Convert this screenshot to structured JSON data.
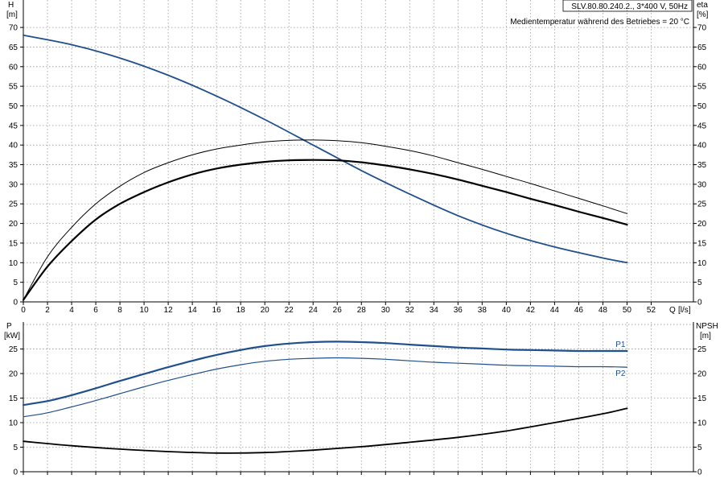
{
  "header": {
    "pump_label": "SLV.80.80.240.2., 3*400 V, 50Hz",
    "medium_note": "Medientemperatur während des Betriebes = 20 °C"
  },
  "chart_data": [
    {
      "type": "line",
      "name": "head-efficiency",
      "axes": {
        "y_left_label": "H",
        "y_left_unit": "[m]",
        "y_right_label": "eta",
        "y_right_unit": "[%]",
        "x_label": "Q",
        "x_unit": "[l/s]"
      },
      "xlim": [
        0,
        55.5
      ],
      "ylim": [
        0,
        77
      ],
      "xticks": [
        0,
        2,
        4,
        6,
        8,
        10,
        12,
        14,
        16,
        18,
        20,
        22,
        24,
        26,
        28,
        30,
        32,
        34,
        36,
        38,
        40,
        42,
        44,
        46,
        48,
        50,
        52
      ],
      "yticks": [
        0,
        5,
        10,
        15,
        20,
        25,
        30,
        35,
        40,
        45,
        50,
        55,
        60,
        65,
        70
      ],
      "grid": true,
      "series": [
        {
          "role": "head",
          "color": "#1f4f8c",
          "width": 1.8,
          "x": [
            0,
            4,
            8,
            12,
            16,
            20,
            24,
            28,
            32,
            36,
            40,
            44,
            48,
            50
          ],
          "y": [
            68,
            65.6,
            62.2,
            57.8,
            52.5,
            46.5,
            40,
            33.5,
            27.5,
            22,
            17.5,
            14,
            11.2,
            10
          ]
        },
        {
          "role": "eta",
          "color": "#000000",
          "width": 1.0,
          "x": [
            0,
            2,
            4,
            6,
            8,
            10,
            12,
            14,
            16,
            18,
            20,
            22,
            24,
            26,
            28,
            30,
            32,
            34,
            36,
            38,
            40,
            42,
            44,
            46,
            48,
            50
          ],
          "y": [
            0.5,
            11.5,
            19,
            25,
            29.5,
            33,
            35.5,
            37.5,
            39,
            40,
            40.8,
            41.2,
            41.3,
            41.1,
            40.6,
            39.7,
            38.6,
            37.2,
            35.5,
            33.8,
            32,
            30.2,
            28.3,
            26.4,
            24.5,
            22.5
          ]
        },
        {
          "role": "eta-2",
          "color": "#000000",
          "width": 2.2,
          "x": [
            0,
            2,
            4,
            6,
            8,
            10,
            12,
            14,
            16,
            18,
            20,
            22,
            24,
            26,
            28,
            30,
            32,
            34,
            36,
            38,
            40,
            42,
            44,
            46,
            48,
            50
          ],
          "y": [
            0.5,
            9,
            15.5,
            21,
            25,
            28,
            30.5,
            32.5,
            34,
            35,
            35.7,
            36.1,
            36.2,
            36.1,
            35.6,
            34.8,
            33.8,
            32.6,
            31.2,
            29.6,
            28,
            26.3,
            24.7,
            23,
            21.4,
            19.7
          ]
        }
      ]
    },
    {
      "type": "line",
      "name": "power-npsh",
      "axes": {
        "y_left_label": "P",
        "y_left_unit": "[kW]",
        "y_right_label": "NPSH",
        "y_right_unit": "[m]"
      },
      "xlim": [
        0,
        55.5
      ],
      "ylim": [
        0,
        30.5
      ],
      "yticks": [
        0,
        5,
        10,
        15,
        20,
        25
      ],
      "grid": true,
      "series": [
        {
          "name": "P1",
          "color": "#1f4f8c",
          "width": 2.2,
          "x": [
            0,
            2,
            4,
            6,
            8,
            10,
            12,
            14,
            16,
            18,
            20,
            22,
            24,
            26,
            28,
            30,
            32,
            34,
            36,
            38,
            40,
            42,
            44,
            46,
            48,
            50
          ],
          "y": [
            13.6,
            14.4,
            15.6,
            17,
            18.5,
            19.9,
            21.3,
            22.6,
            23.8,
            24.8,
            25.6,
            26.1,
            26.4,
            26.5,
            26.4,
            26.2,
            25.9,
            25.6,
            25.3,
            25.1,
            24.9,
            24.8,
            24.7,
            24.6,
            24.6,
            24.6
          ]
        },
        {
          "name": "P2",
          "color": "#1f4f8c",
          "width": 1.2,
          "x": [
            0,
            2,
            4,
            6,
            8,
            10,
            12,
            14,
            16,
            18,
            20,
            22,
            24,
            26,
            28,
            30,
            32,
            34,
            36,
            38,
            40,
            42,
            44,
            46,
            48,
            50
          ],
          "y": [
            11.2,
            12,
            13.2,
            14.5,
            15.9,
            17.3,
            18.6,
            19.8,
            20.9,
            21.8,
            22.5,
            22.9,
            23.1,
            23.2,
            23.1,
            22.9,
            22.6,
            22.3,
            22.1,
            21.9,
            21.7,
            21.6,
            21.5,
            21.4,
            21.4,
            21.3
          ]
        },
        {
          "role": "npsh",
          "color": "#000000",
          "width": 1.8,
          "x": [
            0,
            4,
            8,
            12,
            16,
            20,
            24,
            28,
            32,
            36,
            40,
            44,
            48,
            50
          ],
          "y": [
            6.2,
            5.3,
            4.6,
            4.1,
            3.8,
            3.9,
            4.4,
            5.1,
            6,
            7,
            8.3,
            10,
            11.8,
            12.9
          ]
        }
      ]
    }
  ]
}
